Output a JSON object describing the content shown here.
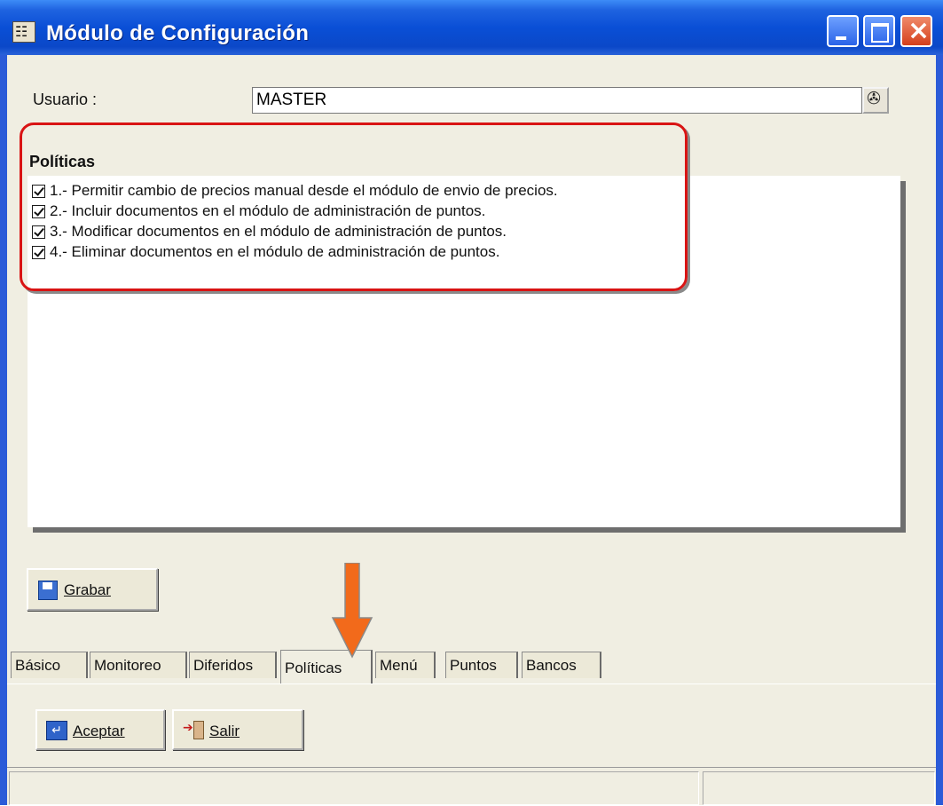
{
  "window": {
    "title": "Módulo de Configuración",
    "icon": "app-icon",
    "controls": [
      "minimize-icon",
      "maximize-icon",
      "close-icon"
    ]
  },
  "user": {
    "label": "Usuario :",
    "value": "MASTER",
    "lookup_icon": "lookup-icon"
  },
  "policies": {
    "heading": "Políticas",
    "items": [
      {
        "label": "1.- Permitir cambio de precios manual desde el módulo de envio de precios.",
        "checked": true
      },
      {
        "label": "2.- Incluir documentos en el módulo de administración de puntos.",
        "checked": true
      },
      {
        "label": "3.- Modificar documentos en el módulo de administración de puntos.",
        "checked": true
      },
      {
        "label": "4.- Eliminar documentos en el módulo de administración de puntos.",
        "checked": true
      }
    ]
  },
  "buttons": {
    "grabar": "Grabar",
    "aceptar": "Aceptar",
    "salir": "Salir"
  },
  "tabs": [
    "Básico",
    "Monitoreo",
    "Diferidos",
    "Políticas",
    "Menú",
    "Puntos",
    "Bancos"
  ],
  "active_tab": "Políticas",
  "colors": {
    "titlebar": "#0a4fd6",
    "highlight": "#d91414",
    "arrow": "#f26a1b",
    "panel": "#f0eee2"
  }
}
